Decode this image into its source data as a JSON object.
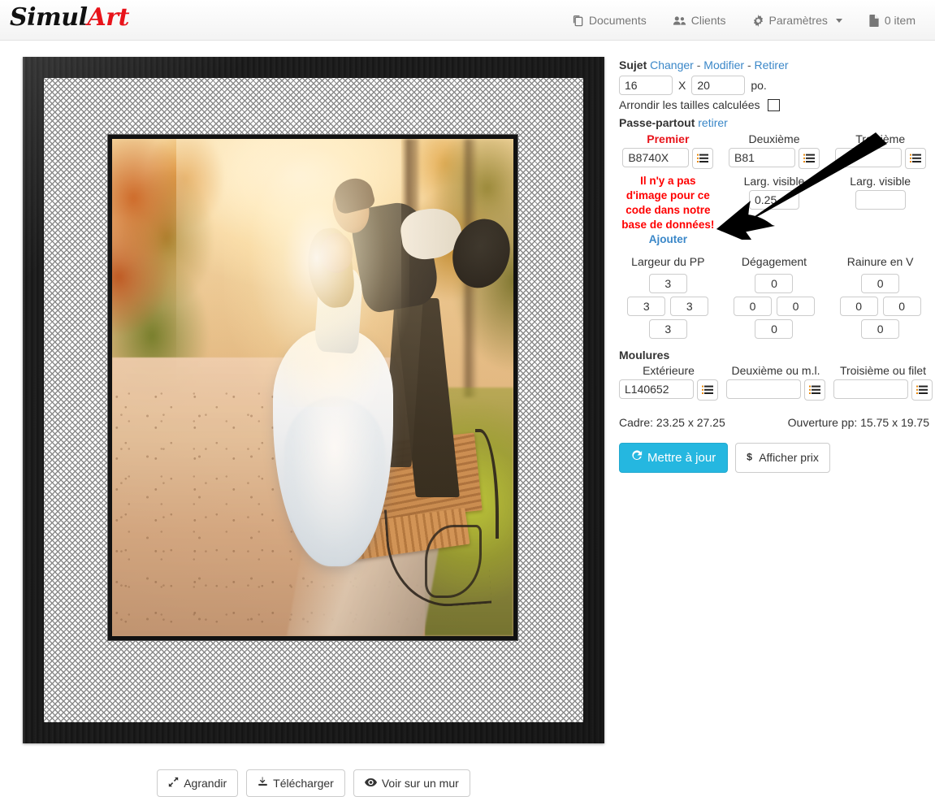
{
  "header": {
    "brand_first": "Simul",
    "brand_second": "Art",
    "nav": [
      {
        "label": "Documents",
        "icon": "documents-icon"
      },
      {
        "label": "Clients",
        "icon": "users-icon"
      },
      {
        "label": "Paramètres",
        "icon": "gear-icon",
        "caret": true
      },
      {
        "label": "0 item",
        "icon": "file-icon"
      }
    ]
  },
  "preview": {
    "photo_alt": "wedding-couple-autumn-park",
    "actions": [
      {
        "label": "Agrandir",
        "icon": "expand-icon"
      },
      {
        "label": "Télécharger",
        "icon": "download-icon"
      },
      {
        "label": "Voir sur un mur",
        "icon": "eye-icon"
      }
    ]
  },
  "panel": {
    "subject": {
      "title": "Sujet",
      "links": [
        "Changer",
        "Modifier",
        "Retirer"
      ],
      "separator": "-",
      "width": "16",
      "x": "X",
      "height": "20",
      "unit": "po."
    },
    "round_sizes": {
      "label": "Arrondir les tailles calculées",
      "checked": false
    },
    "mat": {
      "title": "Passe-partout",
      "remove_link": "retirer",
      "columns": [
        {
          "title": "Premier",
          "code": "B8740X",
          "visible_label": "",
          "visible_value": ""
        },
        {
          "title": "Deuxième",
          "code": "B81",
          "visible_label": "Larg. visible",
          "visible_value": "0.25"
        },
        {
          "title": "Troisième",
          "code": "",
          "visible_label": "Larg. visible",
          "visible_value": ""
        }
      ],
      "error": {
        "text": "Il n'y a pas d'image pour ce code dans notre base de données!",
        "link": "Ajouter"
      }
    },
    "widths": {
      "groups": [
        {
          "title": "Largeur du PP",
          "top": "3",
          "left": "3",
          "right": "3",
          "bottom": "3"
        },
        {
          "title": "Dégagement",
          "top": "0",
          "left": "0",
          "right": "0",
          "bottom": "0"
        },
        {
          "title": "Rainure en V",
          "top": "0",
          "left": "0",
          "right": "0",
          "bottom": "0"
        }
      ]
    },
    "mouldings": {
      "title": "Moulures",
      "columns": [
        {
          "title": "Extérieure",
          "code": "L140652"
        },
        {
          "title": "Deuxième ou m.l.",
          "code": ""
        },
        {
          "title": "Troisième ou filet",
          "code": ""
        }
      ]
    },
    "totals": {
      "frame": "Cadre: 23.25 x 27.25",
      "opening": "Ouverture pp: 15.75 x 19.75"
    },
    "actions": {
      "update": "Mettre à jour",
      "price": "Afficher prix"
    }
  },
  "colors": {
    "accent": "#25b7e0",
    "link": "#3a87c8",
    "error": "#ff0000",
    "brand_red": "#e8131a",
    "frame": "#1b1b1b"
  }
}
